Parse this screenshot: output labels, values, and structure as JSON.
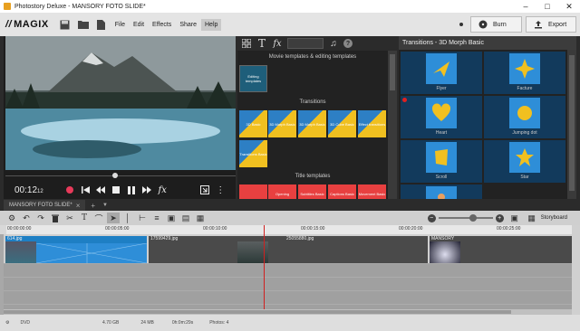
{
  "window": {
    "title": "Photostory Deluxe - MANSORY FOTO SLIDE*",
    "minimize_icon": "minimize-icon",
    "maximize_icon": "maximize-icon",
    "close_icon": "close-icon"
  },
  "menubar": {
    "logo": "MAGIX",
    "items": [
      "File",
      "Edit",
      "Effects",
      "Share",
      "Help"
    ],
    "active_item": "Help",
    "burn_label": "Burn",
    "export_label": "Export"
  },
  "preview": {
    "timecode": "00:12",
    "timecode_frames": "12"
  },
  "templates": {
    "section_movie": "Movie templates & editing templates",
    "section_transitions": "Transitions",
    "section_title": "Title templates",
    "movie_tiles": [
      "Editing templates"
    ],
    "transition_tiles": [
      "3D Basic",
      "3D Morph Basic",
      "3D Morph Basic",
      "3D Cube Basic",
      "Effect transitions",
      "Transitions Basic"
    ],
    "title_tiles": [
      "",
      "Opening",
      "Subtitles Basic",
      "Captions Basic",
      "Movement Basic"
    ]
  },
  "effects_panel": {
    "header": "Transitions - 3D Morph Basic",
    "items": [
      {
        "label": "Flyer",
        "icon": "plane-icon"
      },
      {
        "label": "Facture",
        "icon": "star4-icon"
      },
      {
        "label": "Heart",
        "icon": "heart-icon"
      },
      {
        "label": "Jumping dot",
        "icon": "dot-icon"
      },
      {
        "label": "Scroll",
        "icon": "scroll-icon"
      },
      {
        "label": "Star",
        "icon": "star-icon"
      },
      {
        "label": "",
        "icon": "gingerbread-icon"
      }
    ]
  },
  "project": {
    "tab_label": "MANSORY FOTO SLIDE*",
    "storyboard_label": "Storyboard",
    "ruler": [
      "00:00:00:00",
      "00:00:05:00",
      "00:00:10:00",
      "00:00:15:00",
      "00:00:20:00",
      "00:00:25:00"
    ],
    "clips": [
      "614.jpg",
      "17599429.jpg",
      "25055880.jpg",
      "MANSORY"
    ]
  },
  "status": {
    "medium": "DVD",
    "size": "4.70 GB",
    "used": "24 MB",
    "duration": "0h:0m:29s",
    "photos": "Photos: 4"
  },
  "colors": {
    "accent": "#2e8ed8",
    "record": "#e83a5a",
    "title_tile": "#e84040",
    "transition_yellow": "#f0c020"
  }
}
